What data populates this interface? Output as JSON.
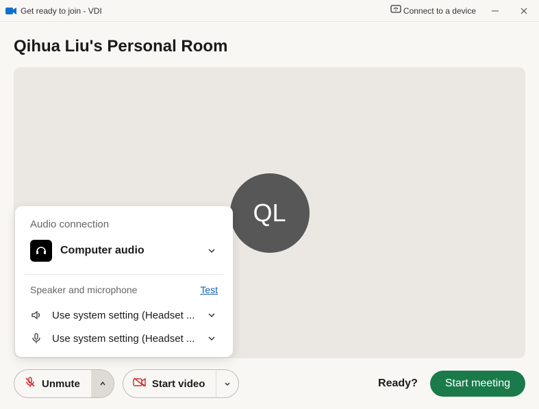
{
  "titlebar": {
    "title": "Get ready to join - VDI",
    "connect_label": "Connect to a device"
  },
  "room": {
    "title": "Qihua Liu's Personal Room",
    "avatar_initials": "QL"
  },
  "audio_popup": {
    "header": "Audio connection",
    "type_label": "Computer audio",
    "section_label": "Speaker and microphone",
    "test_label": "Test",
    "speaker_label": "Use system setting (Headset ...",
    "mic_label": "Use system setting (Headset ..."
  },
  "controls": {
    "unmute_label": "Unmute",
    "video_label": "Start video",
    "ready_label": "Ready?",
    "start_label": "Start meeting"
  }
}
